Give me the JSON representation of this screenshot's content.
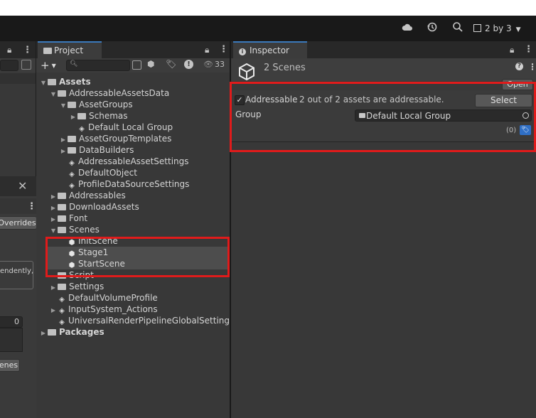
{
  "toolbar": {
    "icons": [
      "cloud-icon",
      "history-icon",
      "search-icon"
    ],
    "layout_label": "2 by 3"
  },
  "left_panel": {
    "overrides_label": "Overrides",
    "text_fragment": "endently,",
    "value": "0",
    "button_label": "enes"
  },
  "project": {
    "tab_label": "Project",
    "search_placeholder": "",
    "hidden_count": "33",
    "tree": [
      {
        "label": "Assets",
        "indent": 0,
        "type": "folder",
        "arrow": "down",
        "bold": true
      },
      {
        "label": "AddressableAssetsData",
        "indent": 1,
        "type": "folder",
        "arrow": "down"
      },
      {
        "label": "AssetGroups",
        "indent": 2,
        "type": "folder",
        "arrow": "down"
      },
      {
        "label": "Schemas",
        "indent": 3,
        "type": "folder",
        "arrow": "right"
      },
      {
        "label": "Default Local Group",
        "indent": 3,
        "type": "asset",
        "arrow": ""
      },
      {
        "label": "AssetGroupTemplates",
        "indent": 2,
        "type": "folder",
        "arrow": "right"
      },
      {
        "label": "DataBuilders",
        "indent": 2,
        "type": "folder",
        "arrow": "right"
      },
      {
        "label": "AddressableAssetSettings",
        "indent": 2,
        "type": "asset",
        "arrow": ""
      },
      {
        "label": "DefaultObject",
        "indent": 2,
        "type": "asset",
        "arrow": ""
      },
      {
        "label": "ProfileDataSourceSettings",
        "indent": 2,
        "type": "asset",
        "arrow": ""
      },
      {
        "label": "Addressables",
        "indent": 1,
        "type": "folder",
        "arrow": "right"
      },
      {
        "label": "DownloadAssets",
        "indent": 1,
        "type": "folder",
        "arrow": "right"
      },
      {
        "label": "Font",
        "indent": 1,
        "type": "folder",
        "arrow": "right"
      },
      {
        "label": "Scenes",
        "indent": 1,
        "type": "folder",
        "arrow": "down"
      },
      {
        "label": "InitScene",
        "indent": 2,
        "type": "scene",
        "arrow": ""
      },
      {
        "label": "Stage1",
        "indent": 2,
        "type": "scene",
        "arrow": "",
        "selected": true
      },
      {
        "label": "StartScene",
        "indent": 2,
        "type": "scene",
        "arrow": "",
        "selected": true
      },
      {
        "label": "Script",
        "indent": 1,
        "type": "folder",
        "arrow": ""
      },
      {
        "label": "Settings",
        "indent": 1,
        "type": "folder",
        "arrow": "right"
      },
      {
        "label": "DefaultVolumeProfile",
        "indent": 1,
        "type": "asset",
        "arrow": ""
      },
      {
        "label": "InputSystem_Actions",
        "indent": 1,
        "type": "asset",
        "arrow": "right"
      },
      {
        "label": "UniversalRenderPipelineGlobalSettings",
        "indent": 1,
        "type": "asset",
        "arrow": ""
      },
      {
        "label": "Packages",
        "indent": 0,
        "type": "folder",
        "arrow": "right",
        "bold": true
      }
    ]
  },
  "inspector": {
    "tab_label": "Inspector",
    "title": "2 Scenes",
    "open_button": "Open",
    "addressable_label": "Addressable",
    "addressable_status": "2 out of 2 assets are addressable.",
    "select_button": "Select",
    "group_label": "Group",
    "group_value": "Default Local Group",
    "labels_count": "(0)"
  },
  "colors": {
    "highlight_red": "#e01b1b",
    "tab_accent": "#3a79bb",
    "label_tag_blue": "#2f6fc6"
  }
}
